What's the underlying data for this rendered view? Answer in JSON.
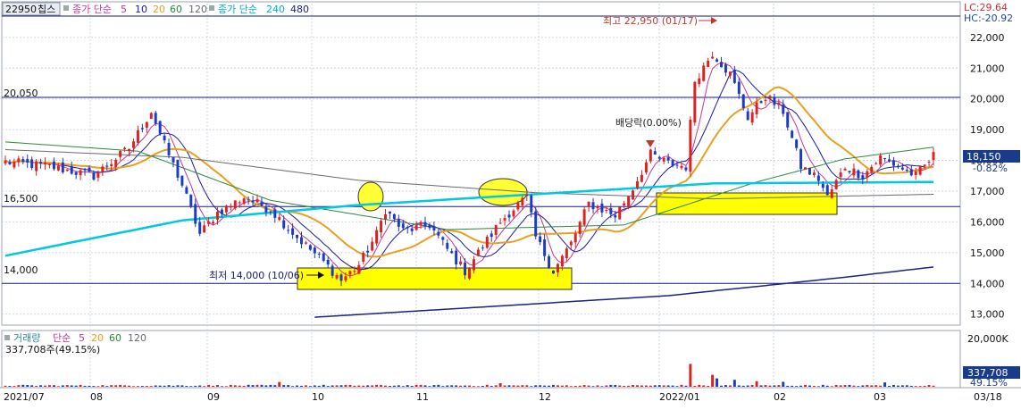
{
  "legend_price": {
    "code": "22950",
    "name": "칩스",
    "ma_label": "종가 단순",
    "ma_periods": [
      "5",
      "10",
      "20",
      "60",
      "120"
    ],
    "ma_colors": [
      "#c0399a",
      "#1a1aa0",
      "#e8a020",
      "#2a8a3a",
      "#6b6b6b"
    ],
    "ma2_label": "종가 단순",
    "ma2_periods": [
      "240",
      "480"
    ],
    "ma2_colors": [
      "#00c8e0",
      "#1a237e"
    ]
  },
  "legend_volume": {
    "label": "거래량",
    "ma_label": "단순",
    "ma_periods": [
      "5",
      "20",
      "60",
      "120"
    ],
    "ma_colors": [
      "#c0399a",
      "#e8a020",
      "#2a8a3a",
      "#6b6b6b"
    ],
    "value_text": "337,708주(49.15%)"
  },
  "info_box": {
    "lc": "LC:29.64",
    "hc": "HC:-20.92"
  },
  "price_panel": {
    "last_price": "18,150",
    "last_change": "-0.82%",
    "horizontal_levels": [
      {
        "label": "20,050",
        "value": 20050
      },
      {
        "label": "16,500",
        "value": 16500
      },
      {
        "label": "14,000",
        "value": 14000
      }
    ],
    "annotations": {
      "high": "최고 22,950 (01/17)",
      "low": "최저 14,000 (10/06)",
      "dividend": "배당락(0.00%)"
    }
  },
  "volume_panel": {
    "axis_label": "20,000K",
    "last_volume": "337,708",
    "last_pct": "49.15%"
  },
  "x_axis": {
    "labels": [
      "2021/07",
      "08",
      "09",
      "10",
      "11",
      "12",
      "2022/01",
      "02",
      "03"
    ],
    "end_label": "03/18"
  },
  "chart_data": {
    "type": "candlestick",
    "title": "",
    "ylim": [
      12700,
      23100
    ],
    "y_ticks": [
      "13,000",
      "14,000",
      "15,000",
      "16,000",
      "17,000",
      "18,000",
      "19,000",
      "20,000",
      "21,000",
      "22,000"
    ],
    "y_tick_values": [
      13000,
      14000,
      15000,
      16000,
      17000,
      18000,
      19000,
      20000,
      21000,
      22000
    ],
    "close_pivots": [
      [
        0,
        17950
      ],
      [
        10,
        17800
      ],
      [
        20,
        17500
      ],
      [
        28,
        18400
      ],
      [
        33,
        19600
      ],
      [
        36,
        18500
      ],
      [
        40,
        17200
      ],
      [
        44,
        15600
      ],
      [
        48,
        16300
      ],
      [
        54,
        16800
      ],
      [
        60,
        16400
      ],
      [
        66,
        15500
      ],
      [
        72,
        14700
      ],
      [
        76,
        14100
      ],
      [
        80,
        14600
      ],
      [
        84,
        15600
      ],
      [
        86,
        16400
      ],
      [
        90,
        15700
      ],
      [
        96,
        15900
      ],
      [
        100,
        15100
      ],
      [
        104,
        14400
      ],
      [
        108,
        15200
      ],
      [
        112,
        16000
      ],
      [
        114,
        16300
      ],
      [
        118,
        16800
      ],
      [
        120,
        15500
      ],
      [
        124,
        14400
      ],
      [
        128,
        15300
      ],
      [
        132,
        16600
      ],
      [
        138,
        16200
      ],
      [
        142,
        17100
      ],
      [
        146,
        18200
      ],
      [
        150,
        17900
      ],
      [
        154,
        17800
      ],
      [
        156,
        20600
      ],
      [
        160,
        21500
      ],
      [
        164,
        20800
      ],
      [
        168,
        19400
      ],
      [
        172,
        20100
      ],
      [
        176,
        19600
      ],
      [
        180,
        17800
      ],
      [
        184,
        17400
      ],
      [
        186,
        16800
      ],
      [
        190,
        17800
      ],
      [
        194,
        17500
      ],
      [
        198,
        18100
      ],
      [
        202,
        17800
      ],
      [
        206,
        17500
      ],
      [
        210,
        18150
      ]
    ],
    "candles_count": 211,
    "ma240_points": [
      [
        0,
        14900
      ],
      [
        40,
        16050
      ],
      [
        80,
        16550
      ],
      [
        120,
        16900
      ],
      [
        160,
        17250
      ],
      [
        211,
        17300
      ]
    ],
    "ma480_points": [
      [
        70,
        12900
      ],
      [
        110,
        13250
      ],
      [
        150,
        13600
      ],
      [
        190,
        14200
      ],
      [
        211,
        14550
      ]
    ],
    "ma120_points": [
      [
        0,
        18350
      ],
      [
        40,
        18100
      ],
      [
        80,
        17350
      ],
      [
        120,
        16950
      ],
      [
        160,
        16750
      ],
      [
        211,
        16900
      ]
    ],
    "ma60_points": [
      [
        0,
        18600
      ],
      [
        30,
        18300
      ],
      [
        60,
        16700
      ],
      [
        100,
        15750
      ],
      [
        140,
        15900
      ],
      [
        170,
        17300
      ],
      [
        190,
        18050
      ],
      [
        211,
        18450
      ]
    ],
    "volume_ylim": [
      0,
      22000
    ],
    "volume_spikes": [
      [
        62,
        2400
      ],
      [
        112,
        1800
      ],
      [
        155,
        11500
      ],
      [
        160,
        6000
      ],
      [
        161,
        4200
      ],
      [
        165,
        3500
      ],
      [
        170,
        2800
      ],
      [
        176,
        2500
      ],
      [
        199,
        2200
      ]
    ]
  }
}
